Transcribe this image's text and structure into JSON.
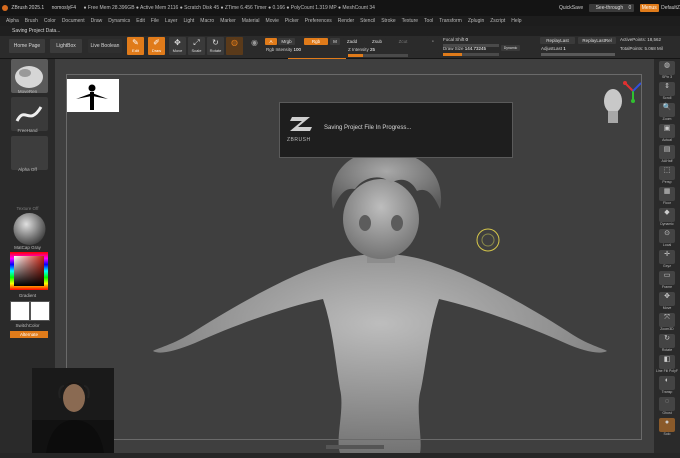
{
  "titlebar": {
    "app": "ZBrush 2025.1",
    "user": "nomoslyF4",
    "stats": "● Free Mem 28.396GB ● Active Mem 2116 ● Scratch Disk 45 ● ZTime 6.456 Timer ● 0.166 ● PolyCount 1.319 MP ● MeshCount 34",
    "quicksave": "QuickSave",
    "seethrough_label": "See-through",
    "seethrough_value": "0",
    "menus_btn": "Menus",
    "default_label": "DefaultZ"
  },
  "menubar": [
    "Alpha",
    "Brush",
    "Color",
    "Document",
    "Draw",
    "Dynamics",
    "Edit",
    "File",
    "Layer",
    "Light",
    "Macro",
    "Marker",
    "Material",
    "Movie",
    "Picker",
    "Preferences",
    "Render",
    "Stencil",
    "Stroke",
    "Texture",
    "Tool",
    "Transform",
    "Zplugin",
    "Zscript",
    "Help"
  ],
  "status": {
    "message": "Saving Project Data...",
    "home_page": "Home Page",
    "lightbox": "LightBox",
    "live_boolean": "Live Boolean"
  },
  "toolbar": {
    "edit": "Edit",
    "draw": "Draw",
    "move": "Move",
    "scale": "Scale",
    "rotate": "Rotate",
    "a_btn": "A",
    "mrgb": "Mrgb",
    "rgb": "Rgb",
    "m": "M",
    "zadd": "Zadd",
    "zsub": "Zsub",
    "zcut": "Zcut",
    "rgb_intensity_label": "Rgb Intensity",
    "rgb_intensity_value": "100",
    "z_intensity_label": "Z Intensity",
    "z_intensity_value": "25",
    "focal_shift_label": "Focal Shift",
    "focal_shift_value": "0",
    "draw_size_label": "Draw Size",
    "draw_size_value": "144.73245",
    "dynamic": "Dynamic",
    "replay_last": "ReplayLast",
    "replay_last_rel": "ReplayLastRel",
    "adjust_last_label": "AdjustLast",
    "adjust_last_value": "1",
    "active_points_label": "ActivePoints:",
    "active_points_value": "18,562",
    "total_points_label": "TotalPoints:",
    "total_points_value": "5.068 Mil"
  },
  "leftshelf": {
    "brush_label": "MoveRen",
    "stroke_label": "FreeHand",
    "alpha_label": "Alpha Off",
    "texture_label": "Texture Off",
    "material_label": "MatCap Gray",
    "gradient_label": "Gradient",
    "switch_color_label": "SwitchColor",
    "alternate_label": "Alternate"
  },
  "dialog": {
    "message": "Saving Project File In Progress...",
    "logo": "ZBRUSH"
  },
  "rightshelf": {
    "labels": [
      "SPix 3",
      "Scroll",
      "Zoom",
      "Actual",
      "AAHalf",
      "Persp",
      "Floor",
      "Dynamic",
      "Local",
      "Gxyz",
      "Frame",
      "Move",
      "Zoom3D",
      "Rotate",
      "Line Fill PolyF",
      "Transp",
      "Ghost",
      "Solo"
    ]
  },
  "canvas_bottom_label": "▲ ▼",
  "colors": {
    "accent": "#e07b1a",
    "canvas_bg": "#3f3f3f",
    "panel_bg": "#2a2a2a"
  }
}
